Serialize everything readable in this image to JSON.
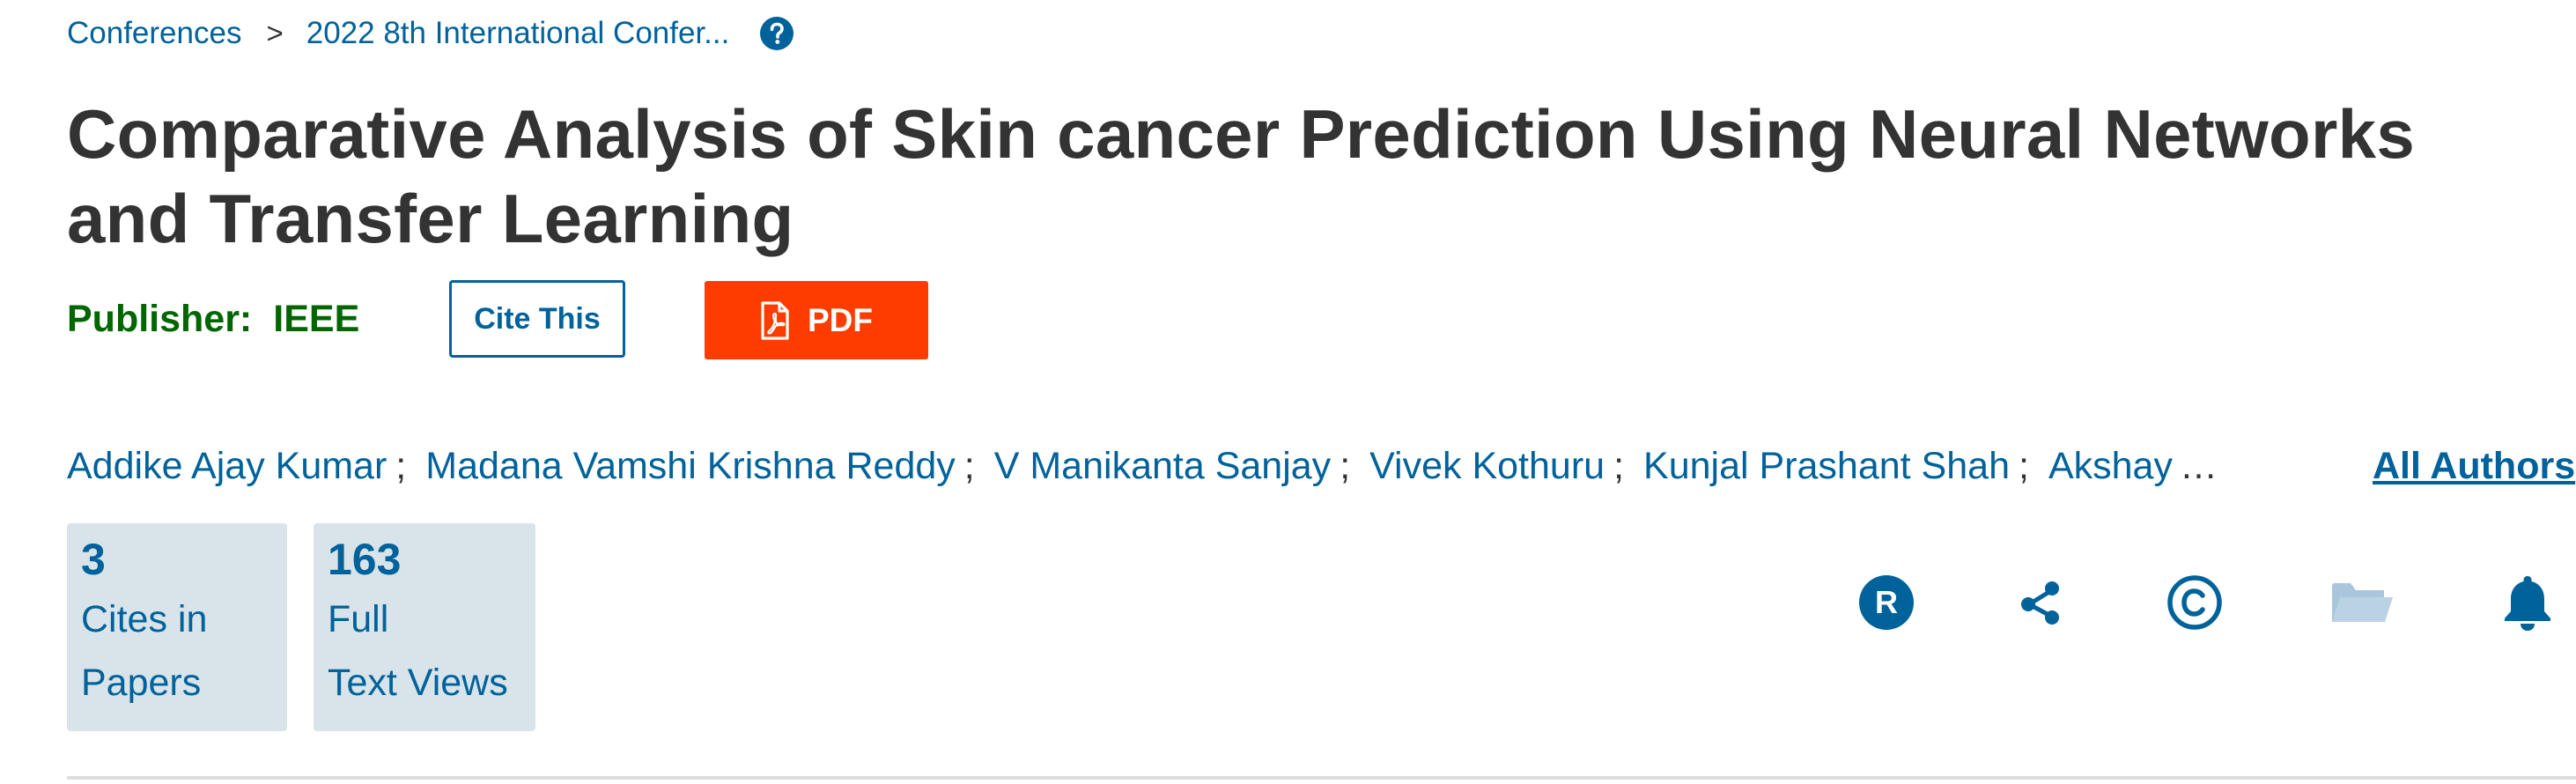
{
  "breadcrumb": {
    "items": [
      "Conferences",
      "2022 8th International Confer..."
    ],
    "separator": ">"
  },
  "article": {
    "title": "Comparative Analysis of Skin cancer Prediction Using Neural Networks and Transfer Learning",
    "publisher_label": "Publisher:",
    "publisher_name": "IEEE"
  },
  "buttons": {
    "cite": "Cite This",
    "pdf": "PDF"
  },
  "authors": {
    "list": [
      "Addike Ajay Kumar",
      "Madana Vamshi Krishna Reddy",
      "V Manikanta Sanjay",
      "Vivek Kothuru",
      "Kunjal Prashant Shah",
      "Akshay"
    ],
    "separator": ";",
    "overflow": "…",
    "all_authors_label": "All Authors"
  },
  "metrics": [
    {
      "value": "3",
      "label_line1": "Cites in",
      "label_line2": "Papers"
    },
    {
      "value": "163",
      "label_line1": "Full",
      "label_line2": "Text Views"
    }
  ],
  "icons": [
    "rights-r-icon",
    "share-icon",
    "copyright-icon",
    "folder-icon",
    "bell-icon"
  ],
  "colors": {
    "link": "#00629b",
    "publisher": "#006600",
    "pdf_button": "#ff3c00",
    "metric_bg": "#d9e4ea",
    "folder_icon": "#a9c6dc"
  }
}
